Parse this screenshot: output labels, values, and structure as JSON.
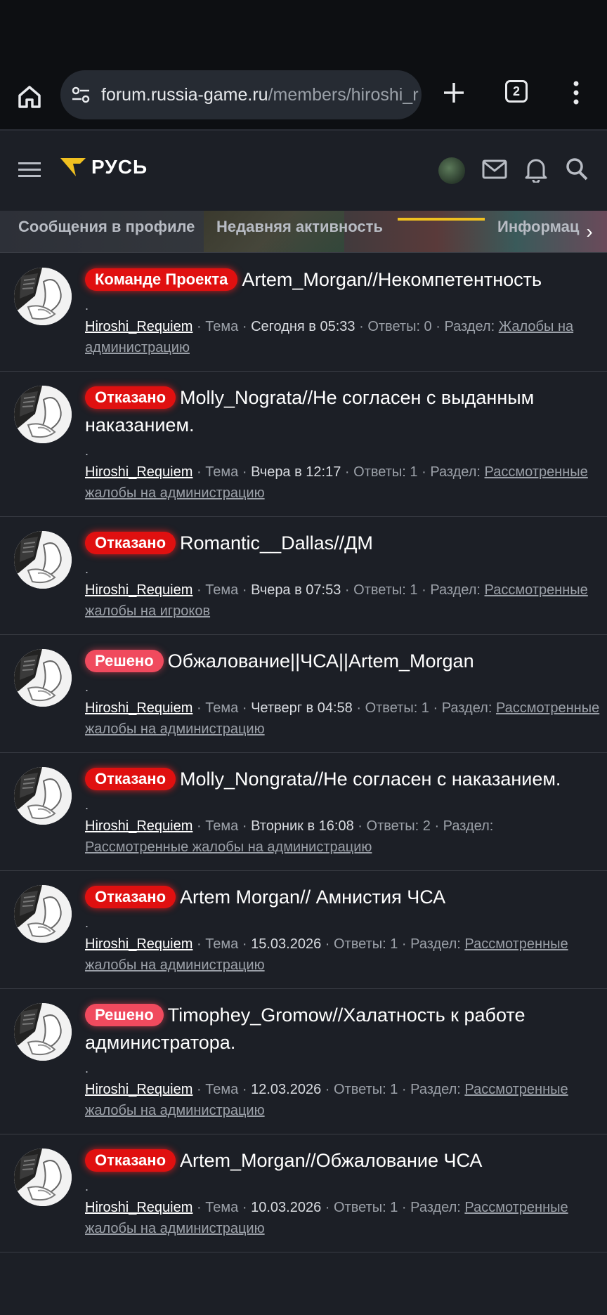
{
  "browser": {
    "url_host": "forum.russia-game.ru",
    "url_path": "/members/hiroshi_r",
    "tab_count": "2"
  },
  "header": {
    "logo_text": "РУСЬ"
  },
  "profile_tabs": [
    {
      "label": "Сообщения в профиле"
    },
    {
      "label": "Недавняя активность"
    },
    {
      "label": ""
    },
    {
      "label": "Информац"
    }
  ],
  "posts": [
    {
      "badge": "Команде Проекта",
      "badge_color": "red",
      "title": "Artem_Morgan//Некомпетентность",
      "dot": ".",
      "user": "Hiroshi_Requiem",
      "type": "Тема",
      "date": "Сегодня в 05:33",
      "replies": "Ответы: 0",
      "section_label": "Раздел:",
      "section": "Жалобы на администрацию"
    },
    {
      "badge": "Отказано",
      "badge_color": "red",
      "title": "Molly_Nograta//Не согласен с выданным наказанием.",
      "dot": ".",
      "user": "Hiroshi_Requiem",
      "type": "Тема",
      "date": "Вчера в 12:17",
      "replies": "Ответы: 1",
      "section_label": "Раздел:",
      "section": "Рассмотренные жалобы на администрацию"
    },
    {
      "badge": "Отказано",
      "badge_color": "red",
      "title": "Romantic__Dallas//ДМ",
      "dot": ".",
      "user": "Hiroshi_Requiem",
      "type": "Тема",
      "date": "Вчера в 07:53",
      "replies": "Ответы: 1",
      "section_label": "Раздел:",
      "section": "Рассмотренные жалобы на игроков"
    },
    {
      "badge": "Решено",
      "badge_color": "pink",
      "title": "Обжалование||ЧСА||Artem_Morgan",
      "dot": ".",
      "user": "Hiroshi_Requiem",
      "type": "Тема",
      "date": "Четверг в 04:58",
      "replies": "Ответы: 1",
      "section_label": "Раздел:",
      "section": "Рассмотренные жалобы на администрацию"
    },
    {
      "badge": "Отказано",
      "badge_color": "red",
      "title": "Molly_Nongrata//Не согласен с наказанием.",
      "dot": ".",
      "user": "Hiroshi_Requiem",
      "type": "Тема",
      "date": "Вторник в 16:08",
      "replies": "Ответы: 2",
      "section_label": "Раздел:",
      "section": "Рассмотренные жалобы на администрацию"
    },
    {
      "badge": "Отказано",
      "badge_color": "red",
      "title": "Artem Morgan// Амнистия ЧСА",
      "dot": ".",
      "user": "Hiroshi_Requiem",
      "type": "Тема",
      "date": "15.03.2026",
      "replies": "Ответы: 1",
      "section_label": "Раздел:",
      "section": "Рассмотренные жалобы на администрацию"
    },
    {
      "badge": "Решено",
      "badge_color": "pink",
      "title": "Timophey_Gromow//Халатность к работе администратора.",
      "dot": ".",
      "user": "Hiroshi_Requiem",
      "type": "Тема",
      "date": "12.03.2026",
      "replies": "Ответы: 1",
      "section_label": "Раздел:",
      "section": "Рассмотренные жалобы на администрацию"
    },
    {
      "badge": "Отказано",
      "badge_color": "red",
      "title": "Artem_Morgan//Обжалование ЧСА",
      "dot": ".",
      "user": "Hiroshi_Requiem",
      "type": "Тема",
      "date": "10.03.2026",
      "replies": "Ответы: 1",
      "section_label": "Раздел:",
      "section": "Рассмотренные жалобы на администрацию"
    }
  ],
  "colors": {
    "accent": "#f0c020",
    "badge_red": "#e01010",
    "badge_pink": "#f04a5e",
    "background": "#1c1f26"
  }
}
